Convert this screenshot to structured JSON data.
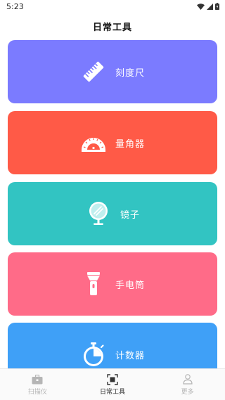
{
  "status_bar": {
    "time": "5:23",
    "icons": [
      "wifi-icon",
      "signal-icon",
      "battery-icon"
    ]
  },
  "header": {
    "title": "日常工具"
  },
  "tools": [
    {
      "label": "刻度尺",
      "icon": "ruler-icon",
      "color": "#7B7BFF"
    },
    {
      "label": "量角器",
      "icon": "protractor-icon",
      "color": "#FF5A47"
    },
    {
      "label": "镜子",
      "icon": "mirror-icon",
      "color": "#32C4C2"
    },
    {
      "label": "手电筒",
      "icon": "flashlight-icon",
      "color": "#FF6B88"
    },
    {
      "label": "计数器",
      "icon": "stopwatch-icon",
      "color": "#3FA0F7"
    }
  ],
  "bottom_nav": {
    "items": [
      {
        "label": "扫描仪",
        "icon": "briefcase-icon",
        "active": false
      },
      {
        "label": "日常工具",
        "icon": "scan-frame-icon",
        "active": true
      },
      {
        "label": "更多",
        "icon": "user-icon",
        "active": false
      }
    ],
    "active_color": "#333333",
    "inactive_color": "#B5B5B5"
  }
}
